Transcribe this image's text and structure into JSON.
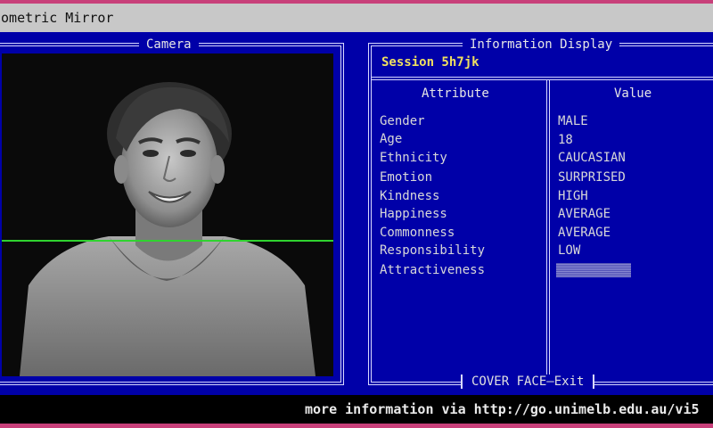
{
  "window": {
    "title": "iometric Mirror"
  },
  "camera": {
    "title": "Camera"
  },
  "info": {
    "title": "Information Display",
    "session": "Session 5h7jk",
    "headers": {
      "attribute": "Attribute",
      "value": "Value"
    },
    "rows": [
      {
        "label": "Gender",
        "value": "MALE"
      },
      {
        "label": "Age",
        "value": "18"
      },
      {
        "label": "Ethnicity",
        "value": "CAUCASIAN"
      },
      {
        "label": "Emotion",
        "value": "SURPRISED"
      },
      {
        "label": "Kindness",
        "value": "HIGH"
      },
      {
        "label": "Happiness",
        "value": "AVERAGE"
      },
      {
        "label": "Commonness",
        "value": "AVERAGE"
      },
      {
        "label": "Responsibility",
        "value": "LOW"
      },
      {
        "label": "Attractiveness",
        "value": ""
      }
    ],
    "exit_label": "COVER FACE—Exit"
  },
  "footer": {
    "text": "more information via http://go.unimelb.edu.au/vi5"
  },
  "colors": {
    "background": "#0000a8",
    "accent": "#c8407a",
    "scan_line": "#2fd32f",
    "session": "#f0e060"
  }
}
